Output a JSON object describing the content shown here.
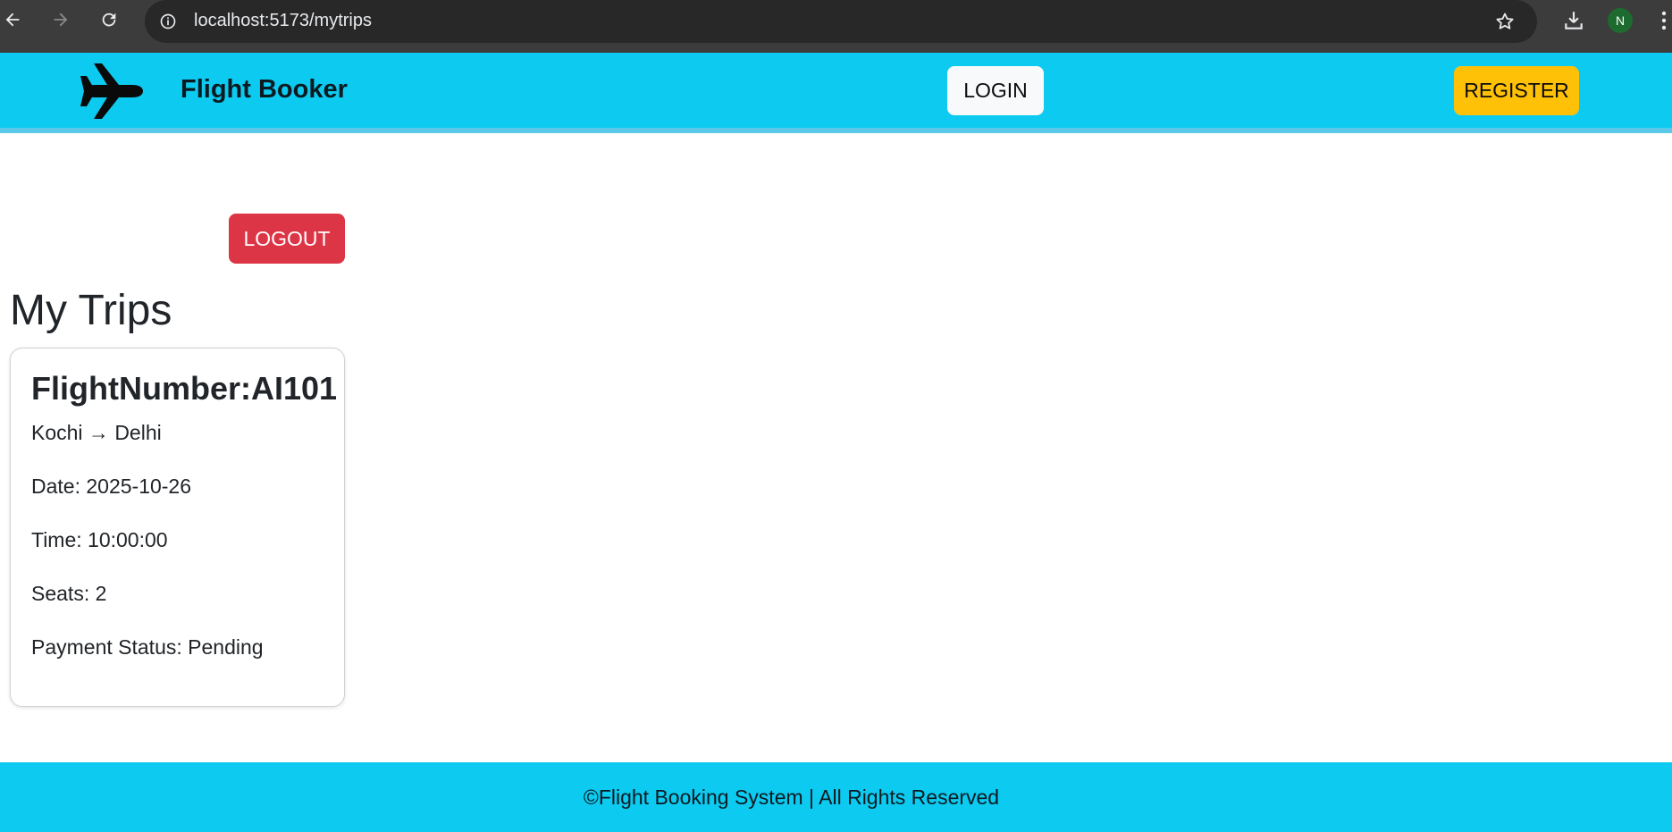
{
  "browser": {
    "url": "localhost:5173/mytrips",
    "profile_initial": "N"
  },
  "header": {
    "brand": "Flight Booker",
    "login_label": "LOGIN",
    "register_label": "REGISTER",
    "logo_icon": "airplane-icon"
  },
  "main": {
    "logout_label": "LOGOUT",
    "title": "My Trips",
    "trips": [
      {
        "flight_label": "FlightNumber:AI101",
        "route": "Kochi → Delhi",
        "date": "Date: 2025-10-26",
        "time": "Time: 10:00:00",
        "seats": "Seats: 2",
        "payment": "Payment Status: Pending"
      }
    ]
  },
  "footer": {
    "text": "©Flight Booking System | All Rights Reserved"
  },
  "colors": {
    "header_bg": "#0dcaf0",
    "login_bg": "#f8f9fa",
    "register_bg": "#ffc107",
    "logout_bg": "#dc3545",
    "chrome_bg": "#3c3c3c",
    "avatar_bg": "#1e6b2f"
  }
}
